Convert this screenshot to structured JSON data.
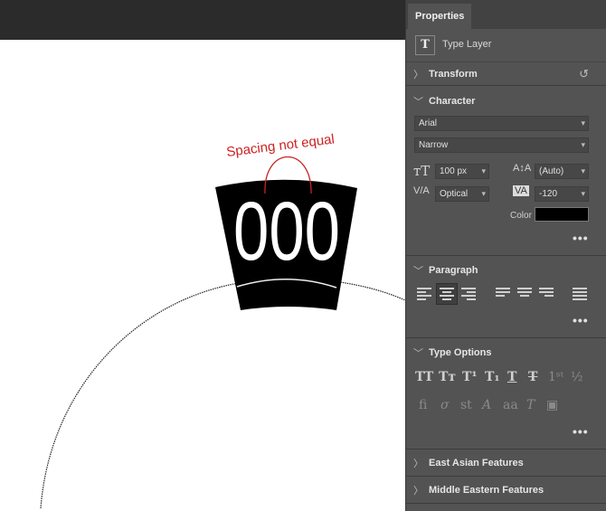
{
  "canvas": {
    "annotation": "Spacing not equal",
    "sample_text": "000"
  },
  "panel": {
    "tab_label": "Properties",
    "layer_label": "Type Layer",
    "sections": {
      "transform": "Transform",
      "character": "Character",
      "paragraph": "Paragraph",
      "type_options": "Type Options",
      "east_asian": "East Asian Features",
      "middle_eastern": "Middle Eastern Features"
    },
    "character": {
      "font_family": "Arial",
      "font_style": "Narrow",
      "font_size": "100 px",
      "leading": "(Auto)",
      "kerning": "Optical",
      "tracking": "-120",
      "color_label": "Color",
      "color_value": "#000000"
    },
    "more": "•••"
  },
  "colors": {
    "annotation_red": "#cc2222",
    "panel_bg": "#535353",
    "topbar": "#2b2b2b"
  }
}
